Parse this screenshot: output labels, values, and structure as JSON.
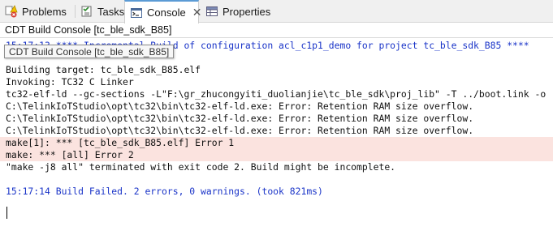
{
  "tabs": [
    {
      "label": "Problems",
      "icon": "problems-icon",
      "active": false
    },
    {
      "label": "Tasks",
      "icon": "tasks-icon",
      "active": false
    },
    {
      "label": "Console",
      "icon": "console-icon",
      "active": true,
      "close": "✕"
    },
    {
      "label": "Properties",
      "icon": "properties-icon",
      "active": false
    }
  ],
  "console": {
    "title": "CDT Build Console [tc_ble_sdk_B85]",
    "tooltip": "CDT Build Console [tc_ble_sdk_B85]",
    "lines": [
      {
        "text": "15:17:13 **** Incremental Build of configuration acl_c1p1_demo for project tc_ble_sdk_B85 ****",
        "kind": "info"
      },
      {
        "text": "",
        "kind": "plain"
      },
      {
        "text": "Building target: tc_ble_sdk_B85.elf",
        "kind": "plain"
      },
      {
        "text": "Invoking: TC32 C Linker",
        "kind": "plain"
      },
      {
        "text": "tc32-elf-ld --gc-sections -L\"F:\\gr_zhucongyiti_duolianjie\\tc_ble_sdk\\proj_lib\" -T ../boot.link -o",
        "kind": "plain"
      },
      {
        "text": "C:\\TelinkIoTStudio\\opt\\tc32\\bin\\tc32-elf-ld.exe: Error: Retention RAM size overflow.",
        "kind": "plain"
      },
      {
        "text": "C:\\TelinkIoTStudio\\opt\\tc32\\bin\\tc32-elf-ld.exe: Error: Retention RAM size overflow.",
        "kind": "plain"
      },
      {
        "text": "C:\\TelinkIoTStudio\\opt\\tc32\\bin\\tc32-elf-ld.exe: Error: Retention RAM size overflow.",
        "kind": "plain"
      },
      {
        "text": "make[1]: *** [tc_ble_sdk_B85.elf] Error 1",
        "kind": "err"
      },
      {
        "text": "make: *** [all] Error 2",
        "kind": "err"
      },
      {
        "text": "\"make -j8 all\" terminated with exit code 2. Build might be incomplete.",
        "kind": "plain"
      },
      {
        "text": "",
        "kind": "plain"
      },
      {
        "text": "15:17:14 Build Failed. 2 errors, 0 warnings. (took 821ms)",
        "kind": "info"
      }
    ]
  },
  "colors": {
    "info_text": "#1a34c8",
    "error_background": "#fbe3df",
    "active_tab_accent": "#5b9bd5"
  }
}
